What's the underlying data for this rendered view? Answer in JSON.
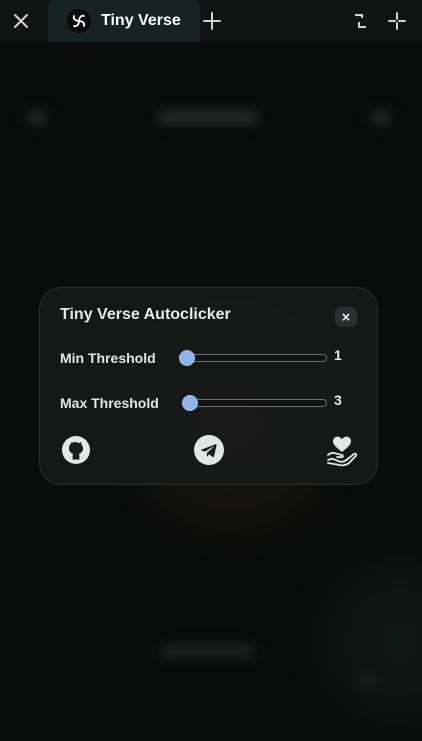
{
  "window": {
    "close_icon": "close-icon",
    "tab": {
      "title": "Tiny Verse",
      "logo_icon": "spiral-logo-icon"
    },
    "new_tab_icon": "plus-icon",
    "restore_icon": "restore-icon",
    "minimize_icon": "collapse-icon"
  },
  "panel": {
    "title": "Tiny Verse Autoclicker",
    "close_label": "×",
    "sliders": [
      {
        "label": "Min Threshold",
        "value": "1"
      },
      {
        "label": "Max Threshold",
        "value": "3"
      }
    ],
    "footer_icons": [
      "github-icon",
      "telegram-icon",
      "donate-heart-hand-icon"
    ],
    "accent_color": "#8fb4e8"
  }
}
